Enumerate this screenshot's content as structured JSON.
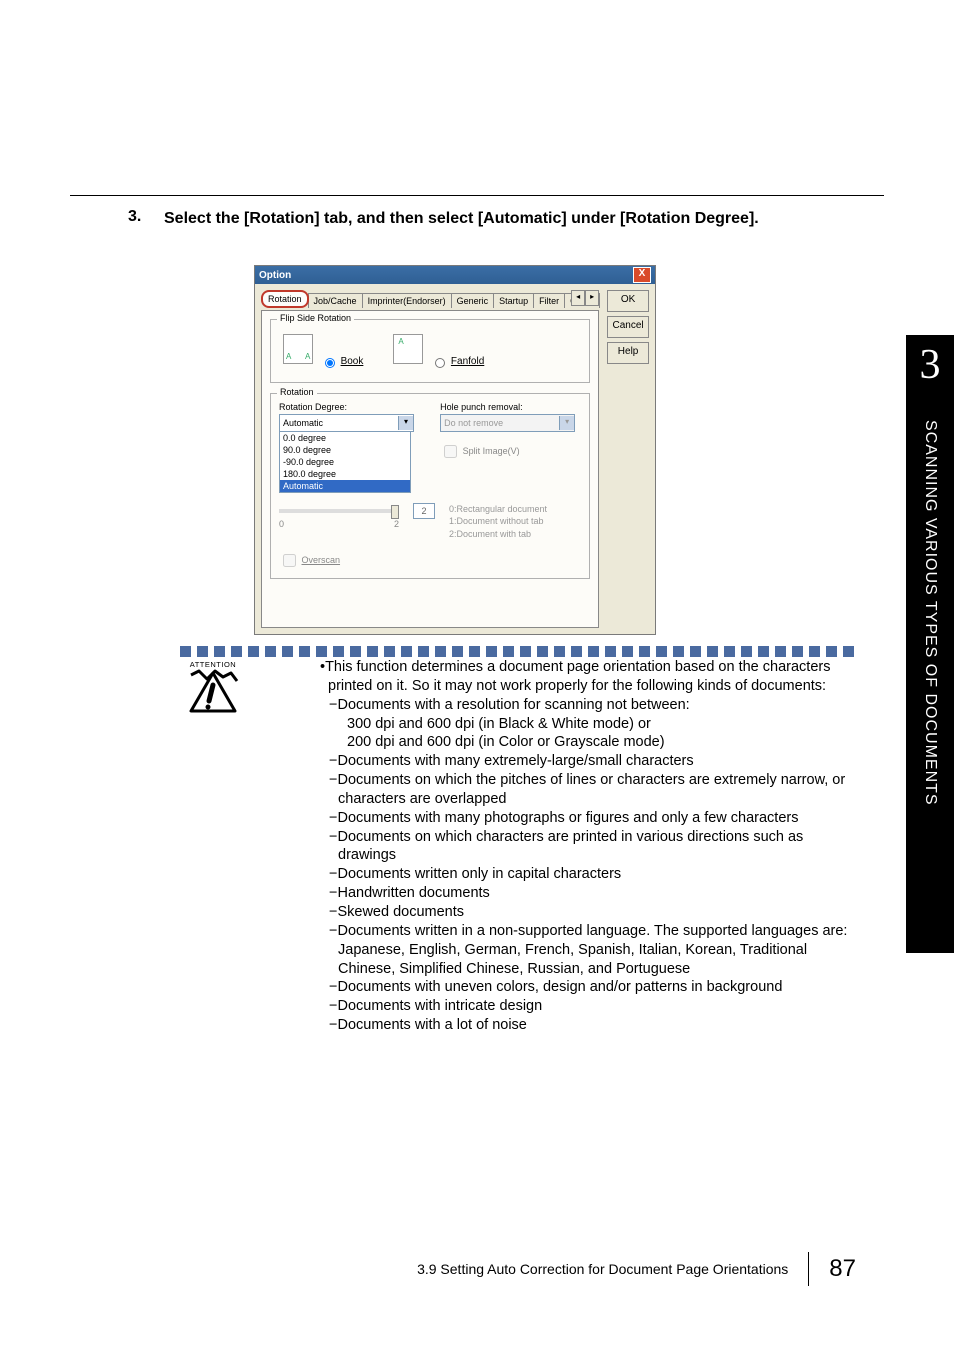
{
  "step": {
    "number": "3.",
    "text": "Select the [Rotation] tab, and then select [Automatic] under [Rotation Degree]."
  },
  "dialog": {
    "title": "Option",
    "close": "X",
    "tabs": {
      "rotation": "Rotation",
      "jobcache": "Job/Cache",
      "imprinter": "Imprinter(Endorser)",
      "generic": "Generic",
      "startup": "Startup",
      "filter": "Filter",
      "comp": "Comp"
    },
    "flip": {
      "legend": "Flip Side Rotation",
      "book": "Book",
      "fanfold": "Fanfold"
    },
    "rotation": {
      "legend": "Rotation",
      "rotation_degree_label": "Rotation Degree:",
      "rotation_degree_value": "Automatic",
      "options": {
        "o0": "0.0 degree",
        "o90": "90.0 degree",
        "o90b": "-90.0 degree",
        "o180": "180.0 degree",
        "auto": "Automatic"
      },
      "hole_punch_label": "Hole punch removal:",
      "hole_punch_value": "Do not remove",
      "split_image": "Split Image(V)",
      "edge_value": "2",
      "edge_list": {
        "e0": "0:Rectangular document",
        "e1": "1:Document without tab",
        "e2": "2:Document with tab"
      },
      "slider_min": "0",
      "slider_max": "2",
      "overscan": "Overscan"
    },
    "buttons": {
      "ok": "OK",
      "cancel": "Cancel",
      "help": "Help"
    }
  },
  "attention": {
    "label": "ATTENTION",
    "intro": "This function determines a document page orientation based on the characters printed on it. So it may not work properly for the following kinds of documents:",
    "items": {
      "i1": "Documents with a resolution for scanning not between:",
      "i1a": "300 dpi and 600 dpi (in Black & White mode) or",
      "i1b": "200 dpi and 600 dpi (in Color or Grayscale mode)",
      "i2": "Documents with many extremely-large/small characters",
      "i3": "Documents on which the pitches of lines or characters are extremely narrow, or characters are overlapped",
      "i4": "Documents with many photographs or figures and only a few characters",
      "i5": "Documents on which characters are printed in various directions such as drawings",
      "i6": "Documents written only in capital characters",
      "i7": "Handwritten documents",
      "i8": "Skewed documents",
      "i9": "Documents written in a non-supported language. The supported languages are: Japanese, English, German, French, Spanish, Italian, Korean, Traditional Chinese, Simplified Chinese, Russian, and Portuguese",
      "i10": "Documents with uneven colors, design and/or patterns in background",
      "i11": "Documents with intricate design",
      "i12": "Documents with a lot of noise"
    }
  },
  "side": {
    "number": "3",
    "text": "SCANNING VARIOUS TYPES OF DOCUMENTS"
  },
  "footer": {
    "title": "3.9 Setting Auto Correction for Document Page Orientations",
    "page": "87"
  }
}
